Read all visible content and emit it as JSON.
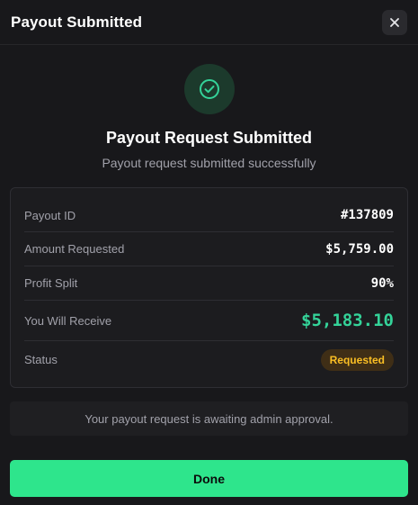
{
  "header": {
    "title": "Payout Submitted",
    "close_icon": "close-icon"
  },
  "hero": {
    "icon": "check-circle-icon",
    "title": "Payout Request Submitted",
    "subtitle": "Payout request submitted successfully"
  },
  "details": {
    "rows": [
      {
        "label": "Payout ID",
        "value": "#137809"
      },
      {
        "label": "Amount Requested",
        "value": "$5,759.00"
      },
      {
        "label": "Profit Split",
        "value": "90%"
      },
      {
        "label": "You Will Receive",
        "value": "$5,183.10"
      },
      {
        "label": "Status",
        "value": "Requested"
      }
    ]
  },
  "notice": "Your payout request is awaiting admin approval.",
  "done_label": "Done",
  "colors": {
    "accent_green": "#2ee58c",
    "receive_green": "#34d399",
    "status_amber": "#fbbf24",
    "background": "#18181b"
  }
}
